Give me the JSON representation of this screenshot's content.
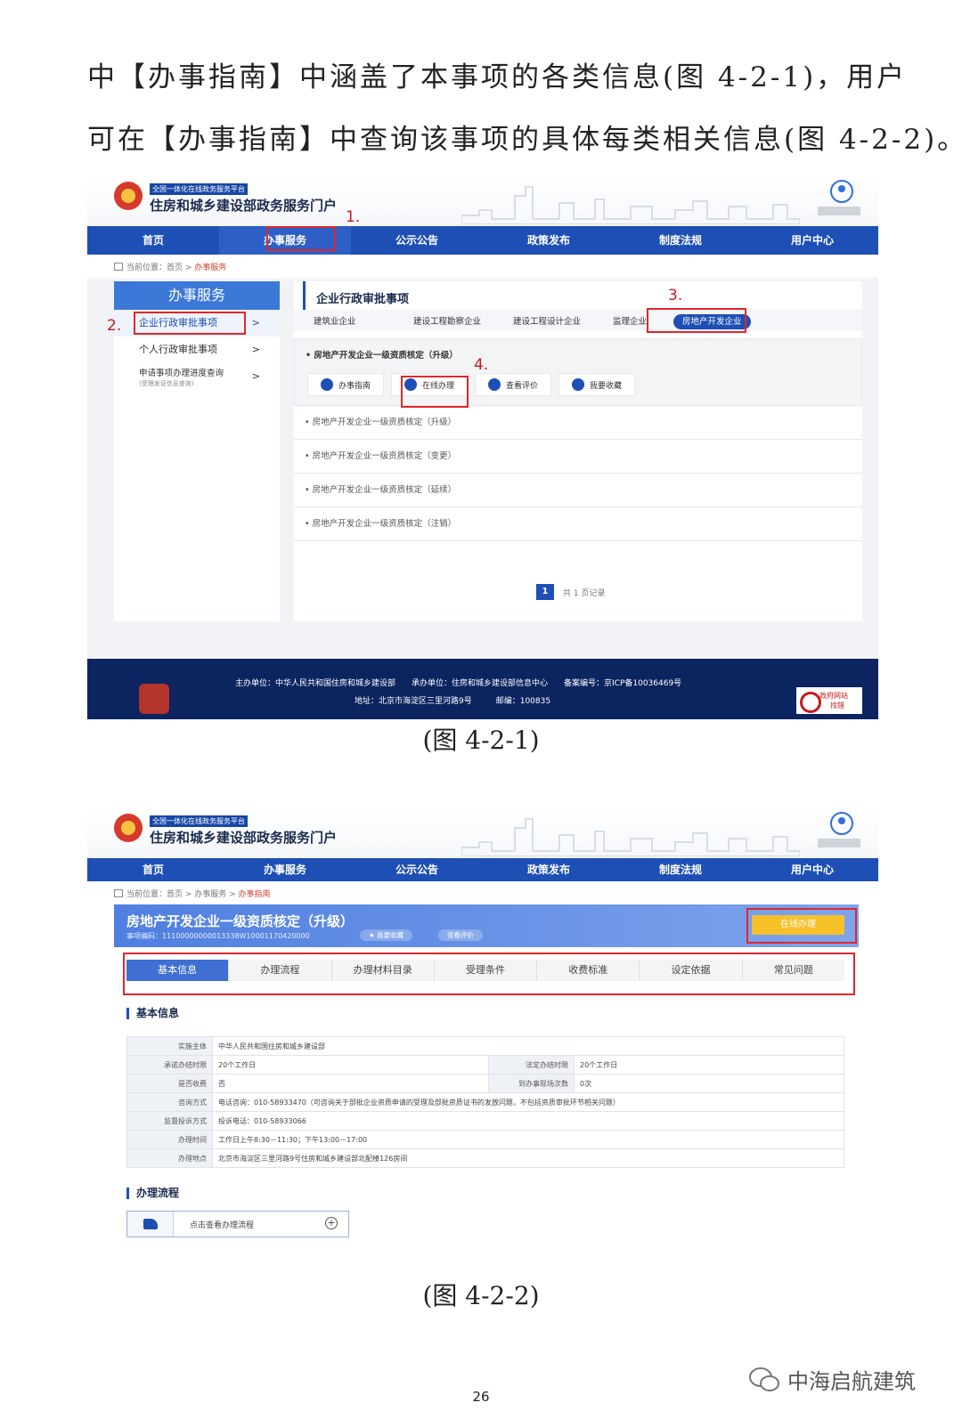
{
  "intro": {
    "line1": "中【办事指南】中涵盖了本事项的各类信息(图 4-2-1)，用户",
    "line2": "可在【办事指南】中查询该事项的具体每类相关信息(图 4-2-2)。"
  },
  "portal": {
    "tag": "全国一体化在线政务服务平台",
    "title": "住房和城乡建设部政务服务门户",
    "nav": [
      "首页",
      "办事服务",
      "公示公告",
      "政策发布",
      "制度法规",
      "用户中心"
    ]
  },
  "fig1": {
    "breadcrumb_prefix": "当前位置：首页 >",
    "breadcrumb_current": "办事服务",
    "markers": [
      "1.",
      "2.",
      "3.",
      "4."
    ],
    "sidebar_title": "办事服务",
    "sidebar_items": [
      {
        "label": "企业行政审批事项"
      },
      {
        "label": "个人行政审批事项"
      },
      {
        "label": "申请事项办理进度查询",
        "sub": "(受理发证信息查询)"
      }
    ],
    "arrow": ">",
    "main_title": "企业行政审批事项",
    "categories": [
      "建筑业企业",
      "建设工程勘察企业",
      "建设工程设计企业",
      "监理企业",
      "房地产开发企业"
    ],
    "expanded_item": "• 房地产开发企业一级资质核定（升级）",
    "actions": [
      "办事指南",
      "在线办理",
      "查看评价",
      "我要收藏"
    ],
    "list": [
      "• 房地产开发企业一级资质核定（升级）",
      "• 房地产开发企业一级资质核定（变更）",
      "• 房地产开发企业一级资质核定（延续）",
      "• 房地产开发企业一级资质核定（注销）"
    ],
    "pager_page": "1",
    "pager_text": "共 1 页记录",
    "footer_line1": "主办单位：中华人民共和国住房和城乡建设部　　承办单位：住房和城乡建设部信息中心　　备案编号：京ICP备10036469号",
    "footer_line2": "地址：北京市海淀区三里河路9号　　　邮编：100835",
    "badge_top": "政府网站",
    "badge_bottom": "找错",
    "caption": "(图 4-2-1)"
  },
  "fig2": {
    "breadcrumb_prefix": "当前位置：首页 > 办事服务 >",
    "breadcrumb_current": "办事指南",
    "banner_title": "房地产开发企业一级资质核定（升级）",
    "banner_code": "事项编码：11100000000013338W10001170420000",
    "pill_fav": "★ 我要收藏",
    "pill_eval": "查看评价",
    "online_button": "在线办理",
    "tabs": [
      "基本信息",
      "办理流程",
      "办理材料目录",
      "受理条件",
      "收费标准",
      "设定依据",
      "常见问题"
    ],
    "section_basic": "基本信息",
    "rows": {
      "impl_k": "实施主体",
      "impl_v": "中华人民共和国住房和城乡建设部",
      "promise_k": "承诺办结时限",
      "promise_v": "20个工作日",
      "legal_k": "法定办结时限",
      "legal_v": "20个工作日",
      "fee_k": "是否收费",
      "fee_v": "否",
      "visit_k": "到办事现场次数",
      "visit_v": "0次",
      "consult_k": "咨询方式",
      "consult_v": "电话咨询：010-58933470（可咨询关于部批企业资质申请的受理及部批资质证书的发放问题，不包括资质审批环节相关问题）",
      "complain_k": "监督投诉方式",
      "complain_v": "投诉电话：010-58933066",
      "time_k": "办理时间",
      "time_v": "工作日上午8:30－11:30；下午13:00－17:00",
      "place_k": "办理地点",
      "place_v": "北京市海淀区三里河路9号住房和城乡建设部北配楼126房间"
    },
    "section_flow": "办理流程",
    "flow_link": "点击查看办理流程",
    "plus": "+",
    "caption": "(图 4-2-2)"
  },
  "page_number": "26",
  "watermark": "中海启航建筑"
}
